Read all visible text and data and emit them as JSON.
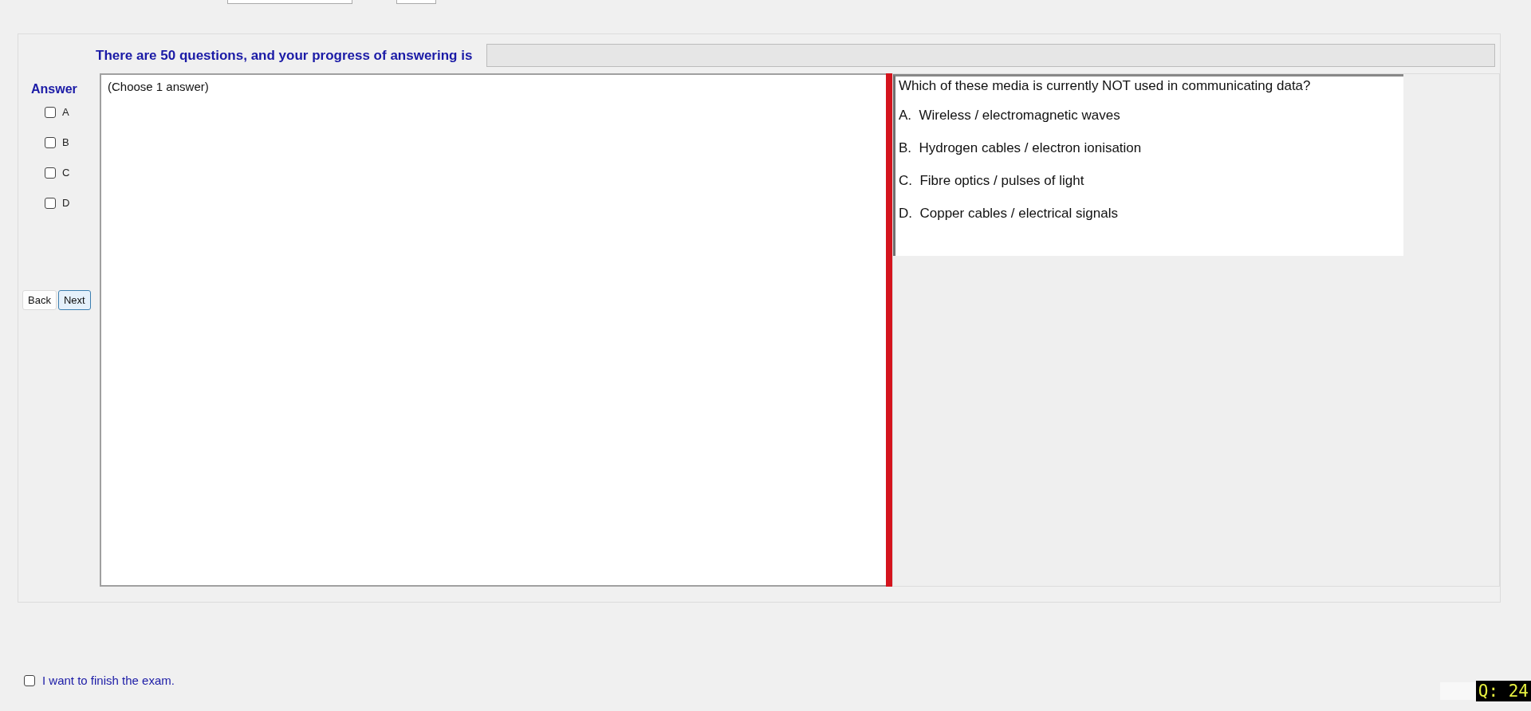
{
  "progress": {
    "label": "There are 50 questions, and your progress of answering is",
    "level": 0
  },
  "answer": {
    "title": "Answer",
    "options": [
      {
        "label": "A",
        "checked": false
      },
      {
        "label": "B",
        "checked": false
      },
      {
        "label": "C",
        "checked": false
      },
      {
        "label": "D",
        "checked": false
      }
    ]
  },
  "nav": {
    "back": "Back",
    "next": "Next"
  },
  "answer_box": {
    "hint": "(Choose 1 answer)"
  },
  "question": {
    "text": "Which of these media is currently NOT used in communicating data?",
    "choices": [
      "A.  Wireless / electromagnetic waves",
      "B.  Hydrogen cables / electron ionisation",
      "C.  Fibre optics / pulses of light",
      "D.  Copper cables / electrical signals"
    ]
  },
  "finish": {
    "label": "I want to finish the exam.",
    "checked": false
  },
  "question_number": "Q: 24"
}
